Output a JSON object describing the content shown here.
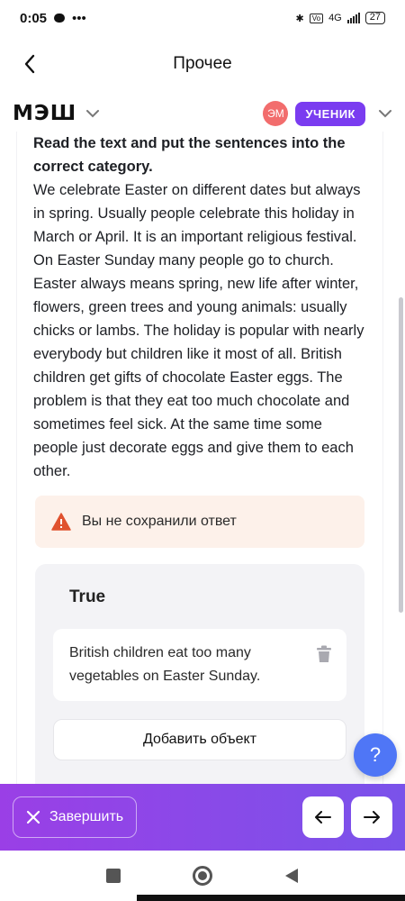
{
  "status_bar": {
    "time": "0:05",
    "net": "4G",
    "battery": "27"
  },
  "header": {
    "title": "Прочее"
  },
  "brand": {
    "logo": "МЭШ",
    "avatar_initials": "ЭМ",
    "role": "УЧЕНИК"
  },
  "task": {
    "instruction": "Read the text and put the sentences into the correct category.",
    "body": "We celebrate Easter on different dates but always in spring. Usually people celebrate this holiday in March or April. It is an important religious festival. On Easter Sunday many people go to church. Easter always means spring, new life after winter, flowers, green trees and young animals: usually chicks or lambs. The holiday is popular with nearly everybody but children like it most of all. British children get gifts of chocolate Easter eggs. The problem is that they eat too much chocolate and sometimes feel sick. At the same time some people just decorate eggs and give them to each other."
  },
  "warning": {
    "text": "Вы не сохранили ответ"
  },
  "category": {
    "title": "True",
    "items": [
      {
        "text": "British children eat too many vegetables on Easter Sunday."
      }
    ],
    "add_label": "Добавить объект"
  },
  "help": {
    "label": "?"
  },
  "action_bar": {
    "finish_label": "Завершить"
  },
  "colors": {
    "accent": "#7a3cf0",
    "fab": "#4f76f6",
    "warning_bg": "#fdf1ea",
    "warning_icon": "#e0522f",
    "avatar": "#f26d6d"
  },
  "icons": {
    "back": "chevron-left-icon",
    "warning": "warning-triangle-icon",
    "trash": "trash-icon",
    "close": "close-icon",
    "prev": "arrow-left-icon",
    "next": "arrow-right-icon"
  }
}
